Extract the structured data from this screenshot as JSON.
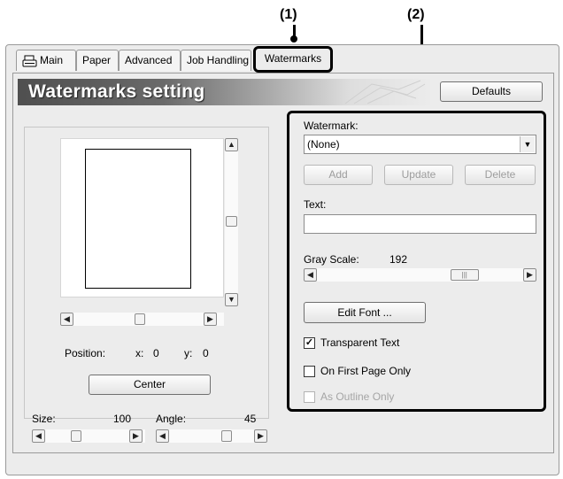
{
  "callouts": {
    "one": "(1)",
    "two": "(2)"
  },
  "tabs": [
    "Main",
    "Paper",
    "Advanced",
    "Job Handling",
    "Watermarks"
  ],
  "banner_title": "Watermarks setting",
  "defaults_button": "Defaults",
  "left": {
    "position_label": "Position:",
    "x_label": "x:",
    "x_value": "0",
    "y_label": "y:",
    "y_value": "0",
    "center_button": "Center",
    "size_label": "Size:",
    "size_value": "100",
    "angle_label": "Angle:",
    "angle_value": "45"
  },
  "right": {
    "watermark_label": "Watermark:",
    "watermark_value": "(None)",
    "add_button": "Add",
    "update_button": "Update",
    "delete_button": "Delete",
    "text_label": "Text:",
    "text_value": "",
    "gray_label": "Gray Scale:",
    "gray_value": "192",
    "gray_fraction": 0.75,
    "edit_font_button": "Edit Font ...",
    "transparent_label": "Transparent Text",
    "transparent_checked": true,
    "first_page_label": "On First Page Only",
    "first_page_checked": false,
    "outline_label": "As Outline Only",
    "outline_checked": false
  }
}
